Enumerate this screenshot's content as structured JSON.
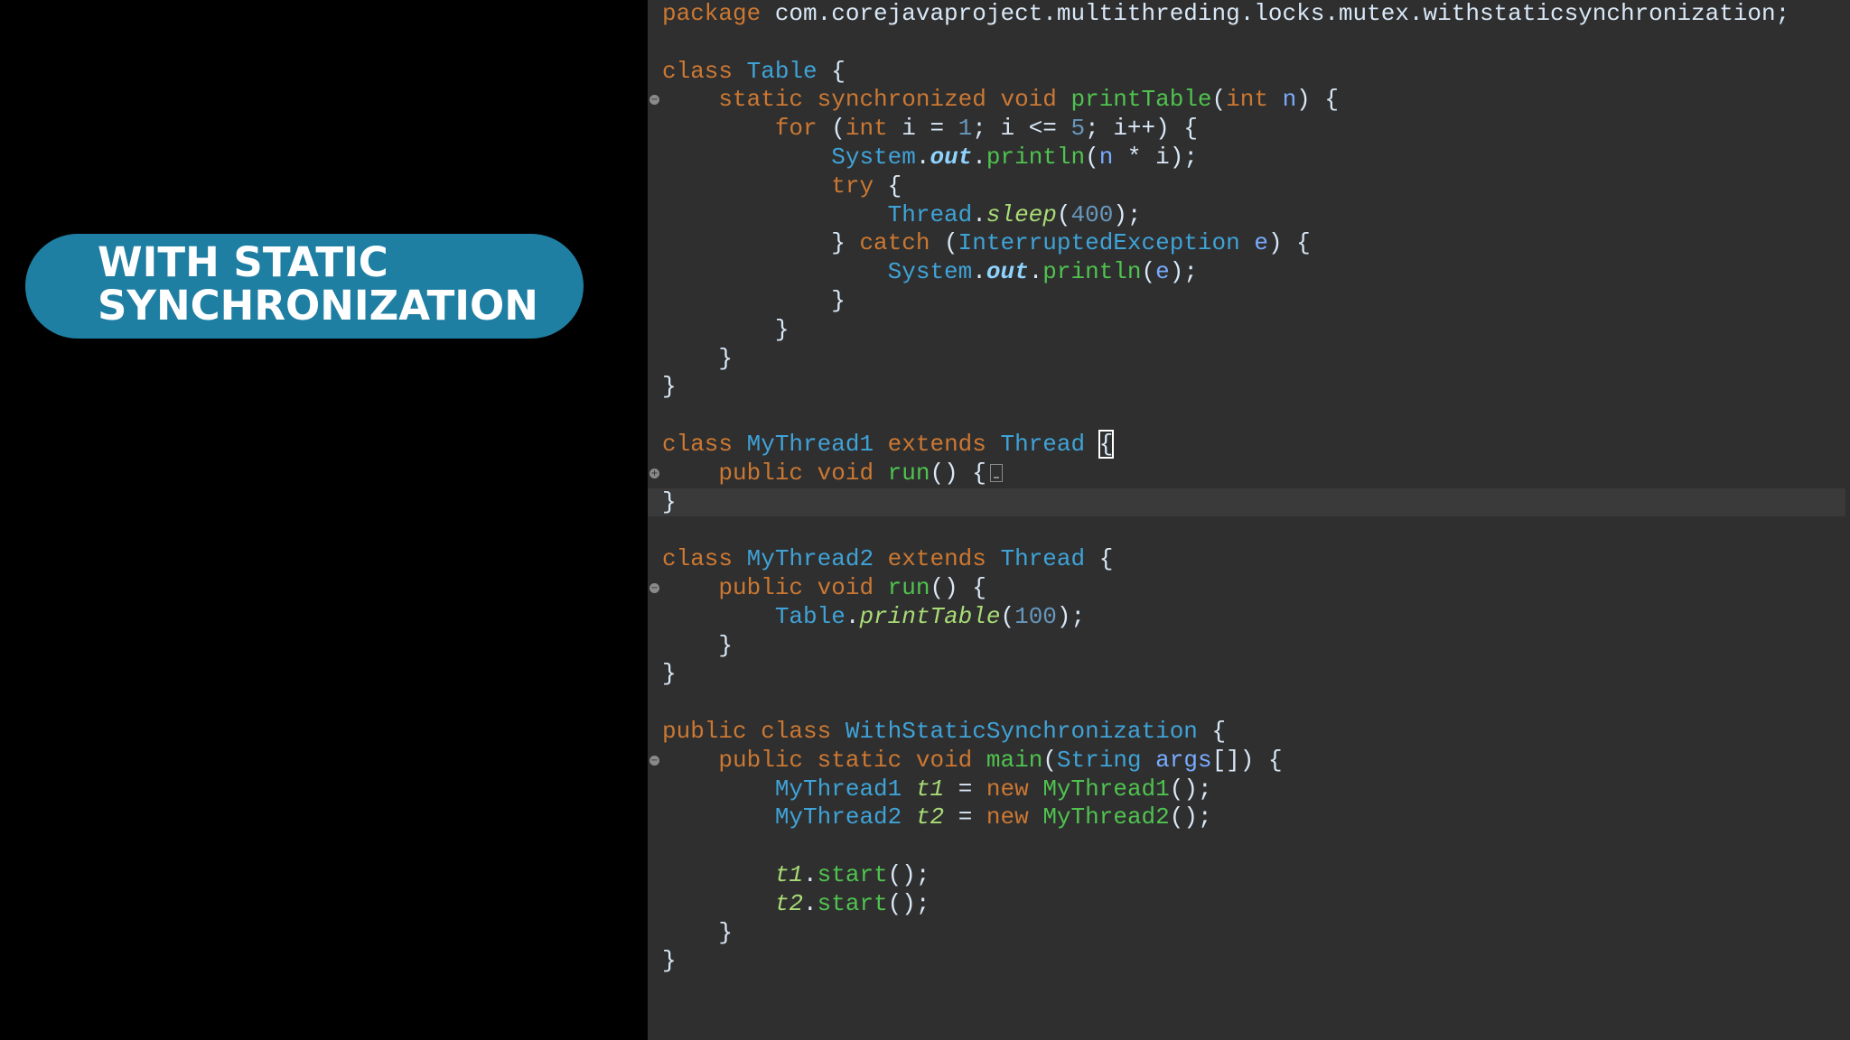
{
  "slide": {
    "title_lines": [
      "WITH STATIC",
      "SYNCHRONIZATION"
    ]
  },
  "editor": {
    "lines": [
      {
        "fold": false,
        "tokens": [
          [
            "kw",
            "package"
          ],
          [
            "pkg",
            " com.corejavaproject.multithreding.locks.mutex.withstaticsynchronization;"
          ]
        ]
      },
      {
        "fold": false,
        "tokens": []
      },
      {
        "fold": false,
        "tokens": [
          [
            "kw",
            "class"
          ],
          [
            "pun",
            " "
          ],
          [
            "typ",
            "Table"
          ],
          [
            "pun",
            " {"
          ]
        ]
      },
      {
        "fold": true,
        "tokens": [
          [
            "pun",
            "    "
          ],
          [
            "kw",
            "static synchronized void"
          ],
          [
            "pun",
            " "
          ],
          [
            "mth",
            "printTable"
          ],
          [
            "pun",
            "("
          ],
          [
            "kw",
            "int"
          ],
          [
            "pun",
            " "
          ],
          [
            "var",
            "n"
          ],
          [
            "pun",
            ") {"
          ]
        ]
      },
      {
        "fold": false,
        "tokens": [
          [
            "pun",
            "        "
          ],
          [
            "kw",
            "for"
          ],
          [
            "pun",
            " ("
          ],
          [
            "kw",
            "int"
          ],
          [
            "pun",
            " i = "
          ],
          [
            "num",
            "1"
          ],
          [
            "pun",
            "; i <= "
          ],
          [
            "num",
            "5"
          ],
          [
            "pun",
            "; i++) {"
          ]
        ]
      },
      {
        "fold": false,
        "tokens": [
          [
            "pun",
            "            "
          ],
          [
            "typ",
            "System"
          ],
          [
            "pun",
            "."
          ],
          [
            "fld",
            "out"
          ],
          [
            "pun",
            "."
          ],
          [
            "mth",
            "println"
          ],
          [
            "pun",
            "("
          ],
          [
            "var",
            "n"
          ],
          [
            "pun",
            " * i);"
          ]
        ]
      },
      {
        "fold": false,
        "tokens": [
          [
            "pun",
            "            "
          ],
          [
            "kw",
            "try"
          ],
          [
            "pun",
            " {"
          ]
        ]
      },
      {
        "fold": false,
        "tokens": [
          [
            "pun",
            "                "
          ],
          [
            "typ",
            "Thread"
          ],
          [
            "pun",
            "."
          ],
          [
            "smth",
            "sleep"
          ],
          [
            "pun",
            "("
          ],
          [
            "num",
            "400"
          ],
          [
            "pun",
            ");"
          ]
        ]
      },
      {
        "fold": false,
        "tokens": [
          [
            "pun",
            "            } "
          ],
          [
            "kw",
            "catch"
          ],
          [
            "pun",
            " ("
          ],
          [
            "typ",
            "InterruptedException"
          ],
          [
            "pun",
            " "
          ],
          [
            "var",
            "e"
          ],
          [
            "pun",
            ") {"
          ]
        ]
      },
      {
        "fold": false,
        "tokens": [
          [
            "pun",
            "                "
          ],
          [
            "typ",
            "System"
          ],
          [
            "pun",
            "."
          ],
          [
            "fld",
            "out"
          ],
          [
            "pun",
            "."
          ],
          [
            "mth",
            "println"
          ],
          [
            "pun",
            "("
          ],
          [
            "var",
            "e"
          ],
          [
            "pun",
            ");"
          ]
        ]
      },
      {
        "fold": false,
        "tokens": [
          [
            "pun",
            "            }"
          ]
        ]
      },
      {
        "fold": false,
        "tokens": [
          [
            "pun",
            "        }"
          ]
        ]
      },
      {
        "fold": false,
        "tokens": [
          [
            "pun",
            "    }"
          ]
        ]
      },
      {
        "fold": false,
        "tokens": [
          [
            "pun",
            "}"
          ]
        ]
      },
      {
        "fold": false,
        "tokens": []
      },
      {
        "fold": false,
        "tokens": [
          [
            "kw",
            "class"
          ],
          [
            "pun",
            " "
          ],
          [
            "typ",
            "MyThread1"
          ],
          [
            "pun",
            " "
          ],
          [
            "kw",
            "extends"
          ],
          [
            "pun",
            " "
          ],
          [
            "typ",
            "Thread"
          ],
          [
            "pun",
            " "
          ],
          [
            "box",
            "{"
          ]
        ]
      },
      {
        "fold": true,
        "collapsed": true,
        "tokens": [
          [
            "pun",
            "    "
          ],
          [
            "kw",
            "public void"
          ],
          [
            "pun",
            " "
          ],
          [
            "mth",
            "run"
          ],
          [
            "pun",
            "() {"
          ]
        ]
      },
      {
        "fold": false,
        "current": true,
        "tokens": [
          [
            "pun",
            "}"
          ]
        ]
      },
      {
        "fold": false,
        "tokens": []
      },
      {
        "fold": false,
        "tokens": [
          [
            "kw",
            "class"
          ],
          [
            "pun",
            " "
          ],
          [
            "typ",
            "MyThread2"
          ],
          [
            "pun",
            " "
          ],
          [
            "kw",
            "extends"
          ],
          [
            "pun",
            " "
          ],
          [
            "typ",
            "Thread"
          ],
          [
            "pun",
            " {"
          ]
        ]
      },
      {
        "fold": true,
        "tokens": [
          [
            "pun",
            "    "
          ],
          [
            "kw",
            "public void"
          ],
          [
            "pun",
            " "
          ],
          [
            "mth",
            "run"
          ],
          [
            "pun",
            "() {"
          ]
        ]
      },
      {
        "fold": false,
        "tokens": [
          [
            "pun",
            "        "
          ],
          [
            "typ",
            "Table"
          ],
          [
            "pun",
            "."
          ],
          [
            "smth",
            "printTable"
          ],
          [
            "pun",
            "("
          ],
          [
            "num",
            "100"
          ],
          [
            "pun",
            ");"
          ]
        ]
      },
      {
        "fold": false,
        "tokens": [
          [
            "pun",
            "    }"
          ]
        ]
      },
      {
        "fold": false,
        "tokens": [
          [
            "pun",
            "}"
          ]
        ]
      },
      {
        "fold": false,
        "tokens": []
      },
      {
        "fold": false,
        "tokens": [
          [
            "kw",
            "public class"
          ],
          [
            "pun",
            " "
          ],
          [
            "typ",
            "WithStaticSynchronization"
          ],
          [
            "pun",
            " {"
          ]
        ]
      },
      {
        "fold": true,
        "tokens": [
          [
            "pun",
            "    "
          ],
          [
            "kw",
            "public static void"
          ],
          [
            "pun",
            " "
          ],
          [
            "mth",
            "main"
          ],
          [
            "pun",
            "("
          ],
          [
            "typ",
            "String"
          ],
          [
            "pun",
            " "
          ],
          [
            "var",
            "args"
          ],
          [
            "pun",
            "[]) {"
          ]
        ]
      },
      {
        "fold": false,
        "tokens": [
          [
            "pun",
            "        "
          ],
          [
            "typ",
            "MyThread1"
          ],
          [
            "pun",
            " "
          ],
          [
            "smth",
            "t1"
          ],
          [
            "pun",
            " = "
          ],
          [
            "kw",
            "new"
          ],
          [
            "pun",
            " "
          ],
          [
            "mth",
            "MyThread1"
          ],
          [
            "pun",
            "();"
          ]
        ]
      },
      {
        "fold": false,
        "tokens": [
          [
            "pun",
            "        "
          ],
          [
            "typ",
            "MyThread2"
          ],
          [
            "pun",
            " "
          ],
          [
            "smth",
            "t2"
          ],
          [
            "pun",
            " = "
          ],
          [
            "kw",
            "new"
          ],
          [
            "pun",
            " "
          ],
          [
            "mth",
            "MyThread2"
          ],
          [
            "pun",
            "();"
          ]
        ]
      },
      {
        "fold": false,
        "tokens": []
      },
      {
        "fold": false,
        "tokens": [
          [
            "pun",
            "        "
          ],
          [
            "smth",
            "t1"
          ],
          [
            "pun",
            "."
          ],
          [
            "mth",
            "start"
          ],
          [
            "pun",
            "();"
          ]
        ]
      },
      {
        "fold": false,
        "tokens": [
          [
            "pun",
            "        "
          ],
          [
            "smth",
            "t2"
          ],
          [
            "pun",
            "."
          ],
          [
            "mth",
            "start"
          ],
          [
            "pun",
            "();"
          ]
        ]
      },
      {
        "fold": false,
        "tokens": [
          [
            "pun",
            "    }"
          ]
        ]
      },
      {
        "fold": false,
        "tokens": [
          [
            "pun",
            "}"
          ]
        ]
      }
    ]
  }
}
